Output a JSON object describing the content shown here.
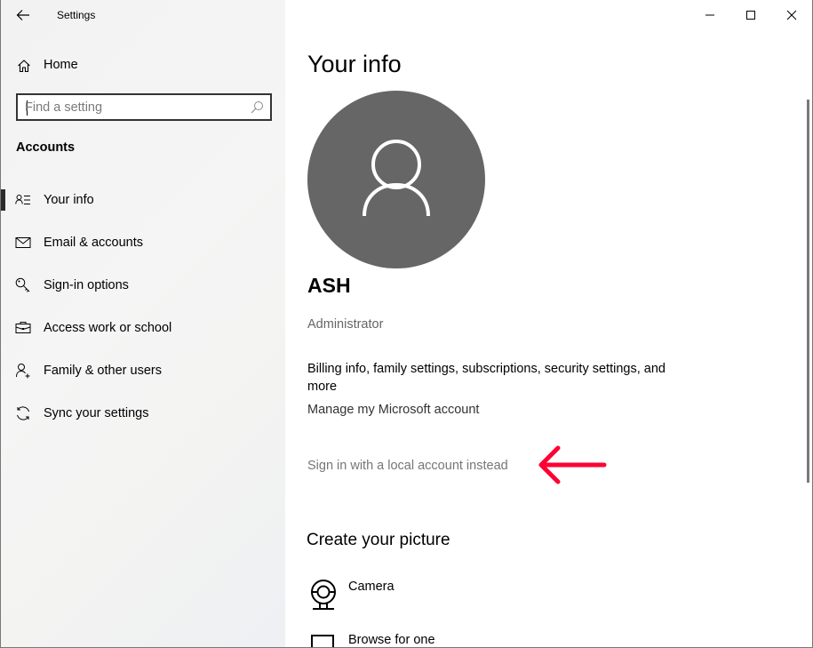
{
  "window": {
    "app_title": "Settings",
    "controls": {
      "minimize": "minimize-icon",
      "maximize": "maximize-icon",
      "close": "close-icon"
    }
  },
  "sidebar": {
    "back_icon": "back-arrow-icon",
    "home": {
      "label": "Home",
      "icon": "home-icon"
    },
    "search": {
      "placeholder": "Find a setting",
      "value": "",
      "icon": "search-icon"
    },
    "section_heading": "Accounts",
    "items": [
      {
        "label": "Your info",
        "icon": "person-list-icon",
        "active": true
      },
      {
        "label": "Email & accounts",
        "icon": "mail-icon",
        "active": false
      },
      {
        "label": "Sign-in options",
        "icon": "key-icon",
        "active": false
      },
      {
        "label": "Access work or school",
        "icon": "briefcase-icon",
        "active": false
      },
      {
        "label": "Family & other users",
        "icon": "person-add-icon",
        "active": false
      },
      {
        "label": "Sync your settings",
        "icon": "sync-icon",
        "active": false
      }
    ]
  },
  "main": {
    "title": "Your info",
    "avatar_icon": "user-avatar-icon",
    "user_name": "ASH",
    "user_role": "Administrator",
    "billing_text": "Billing info, family settings, subscriptions, security settings, and more",
    "manage_link": "Manage my Microsoft account",
    "local_account_link": "Sign in with a local account instead",
    "annotation": {
      "icon": "red-arrow-annotation",
      "color": "#ff0033"
    },
    "create_picture": {
      "heading": "Create your picture",
      "options": [
        {
          "label": "Camera",
          "icon": "webcam-icon"
        },
        {
          "label": "Browse for one",
          "icon": "browse-icon"
        }
      ]
    }
  },
  "colors": {
    "avatar_bg": "#666666",
    "annotation_red": "#ff0033",
    "secondary_text": "#767676"
  }
}
